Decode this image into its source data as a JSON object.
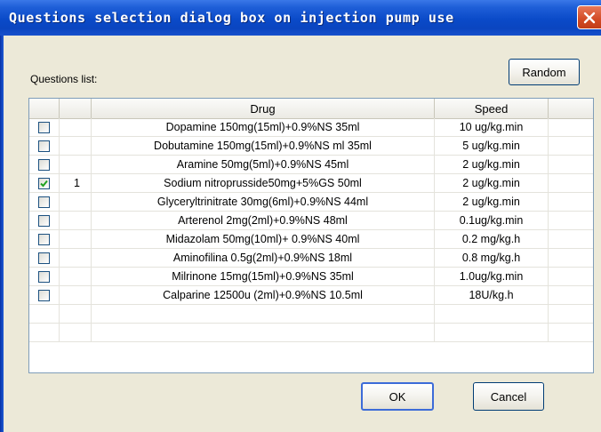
{
  "dialog": {
    "title": "Questions selection dialog box on injection pump use",
    "list_label": "Questions list:",
    "random_label": "Random",
    "ok_label": "OK",
    "cancel_label": "Cancel"
  },
  "table": {
    "headers": {
      "drug": "Drug",
      "speed": "Speed"
    },
    "rows": [
      {
        "checked": false,
        "num": "",
        "drug": "Dopamine 150mg(15ml)+0.9%NS 35ml",
        "speed": "10 ug/kg.min"
      },
      {
        "checked": false,
        "num": "",
        "drug": "Dobutamine 150mg(15ml)+0.9%NS ml 35ml",
        "speed": "5 ug/kg.min"
      },
      {
        "checked": false,
        "num": "",
        "drug": "Aramine 50mg(5ml)+0.9%NS 45ml",
        "speed": "2 ug/kg.min"
      },
      {
        "checked": true,
        "num": "1",
        "drug": "Sodium nitroprusside50mg+5%GS 50ml",
        "speed": "2 ug/kg.min"
      },
      {
        "checked": false,
        "num": "",
        "drug": "Glyceryltrinitrate 30mg(6ml)+0.9%NS 44ml",
        "speed": "2 ug/kg.min"
      },
      {
        "checked": false,
        "num": "",
        "drug": "Arterenol 2mg(2ml)+0.9%NS 48ml",
        "speed": "0.1ug/kg.min"
      },
      {
        "checked": false,
        "num": "",
        "drug": "Midazolam 50mg(10ml)+ 0.9%NS 40ml",
        "speed": "0.2 mg/kg.h"
      },
      {
        "checked": false,
        "num": "",
        "drug": "Aminofilina 0.5g(2ml)+0.9%NS 18ml",
        "speed": "0.8 mg/kg.h"
      },
      {
        "checked": false,
        "num": "",
        "drug": "Milrinone 15mg(15ml)+0.9%NS 35ml",
        "speed": "1.0ug/kg.min"
      },
      {
        "checked": false,
        "num": "",
        "drug": "Calparine 12500u (2ml)+0.9%NS 10.5ml",
        "speed": "18U/kg.h"
      }
    ]
  },
  "icons": {
    "close": "close-icon",
    "check": "checkmark-icon"
  },
  "colors": {
    "titlebar": "#0a4ac8",
    "close_button": "#d24a24",
    "dialog_bg": "#ece9d8",
    "check": "#21a121"
  }
}
